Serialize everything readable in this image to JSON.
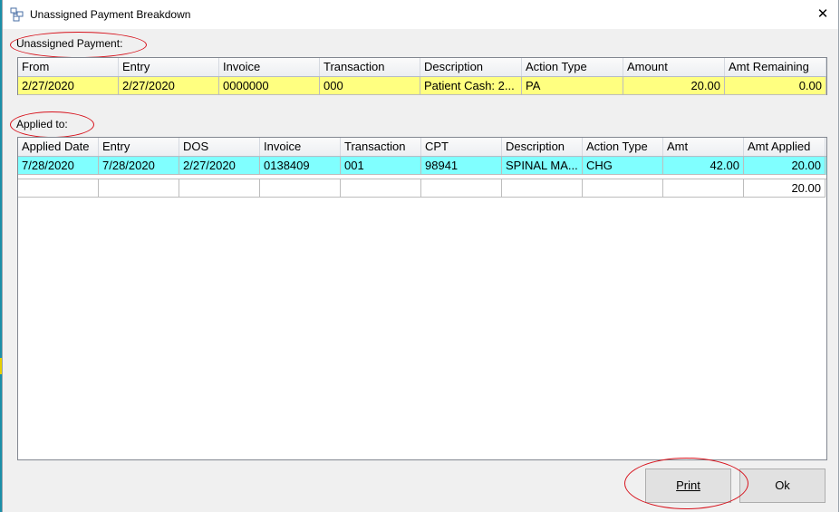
{
  "window": {
    "title": "Unassigned Payment Breakdown",
    "close_glyph": "✕"
  },
  "unassigned": {
    "label": "Unassigned Payment:",
    "columns": [
      "From",
      "Entry",
      "Invoice",
      "Transaction",
      "Description",
      "Action Type",
      "Amount",
      "Amt Remaining"
    ],
    "rows": [
      [
        "2/27/2020",
        "2/27/2020",
        "0000000",
        "000",
        "Patient Cash: 2...",
        "PA",
        "20.00",
        "0.00"
      ]
    ],
    "row_color": "#ffff80"
  },
  "applied": {
    "label": "Applied to:",
    "columns": [
      "Applied Date",
      "Entry",
      "DOS",
      "Invoice",
      "Transaction",
      "CPT",
      "Description",
      "Action Type",
      "Amt",
      "Amt Applied"
    ],
    "rows": [
      [
        "7/28/2020",
        "7/28/2020",
        "2/27/2020",
        "0138409",
        "001",
        "98941",
        "SPINAL MA...",
        "CHG",
        "42.00",
        "20.00"
      ]
    ],
    "total": "20.00",
    "row_color": "#80ffff"
  },
  "buttons": {
    "print": "Print",
    "ok": "Ok"
  },
  "accent": {
    "annotation": "#d7131d"
  }
}
